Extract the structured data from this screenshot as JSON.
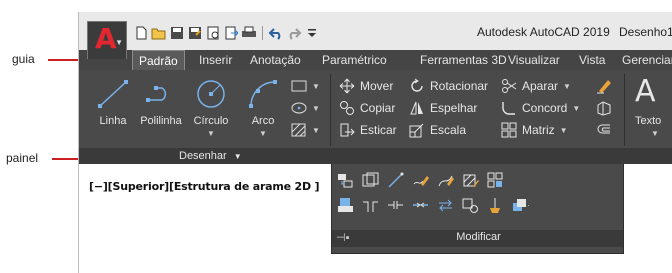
{
  "callouts": {
    "guia": "guia",
    "painel": "painel"
  },
  "titlebar": {
    "app_title": "Autodesk AutoCAD 2019",
    "doc_title": "Desenho1.",
    "logo_letter": "A",
    "quick_access": [
      "new-icon",
      "open-icon",
      "save-icon",
      "save-as-icon",
      "print-preview-icon",
      "export-icon",
      "plot-icon",
      "undo-icon",
      "redo-icon",
      "customize-icon"
    ]
  },
  "tabs": [
    "Padrão",
    "Inserir",
    "Anotação",
    "Paramétrico",
    "Ferramentas 3D",
    "Visualizar",
    "Vista",
    "Gerenciar"
  ],
  "ribbon": {
    "draw_panel": {
      "title": "Desenhar",
      "big_tools": [
        {
          "label": "Linha",
          "icon": "line-icon"
        },
        {
          "label": "Polilinha",
          "icon": "polyline-icon"
        },
        {
          "label": "Círculo",
          "icon": "circle-icon"
        },
        {
          "label": "Arco",
          "icon": "arc-icon"
        }
      ],
      "small_tools": [
        "rectangle-icon",
        "ellipse-icon",
        "hatch-icon"
      ]
    },
    "modify_panel": {
      "title": "Modificar",
      "tools": [
        {
          "label": "Mover",
          "icon": "move-icon"
        },
        {
          "label": "Rotacionar",
          "icon": "rotate-icon"
        },
        {
          "label": "Aparar",
          "icon": "trim-icon"
        },
        {
          "label": "Copiar",
          "icon": "copy-icon"
        },
        {
          "label": "Espelhar",
          "icon": "mirror-icon"
        },
        {
          "label": "Concord",
          "icon": "fillet-icon"
        },
        {
          "label": "Esticar",
          "icon": "stretch-icon"
        },
        {
          "label": "Escala",
          "icon": "scale-icon"
        },
        {
          "label": "Matriz",
          "icon": "array-icon"
        }
      ]
    },
    "annotation_panel": {
      "text_label": "Texto",
      "text_letter": "A"
    }
  },
  "viewport": {
    "label": "[−][Superior][Estrutura de arame 2D ]"
  },
  "colors": {
    "ribbon_bg": "#4a4a4a",
    "tab_bg": "#454545",
    "accent_red": "#cc1f1f",
    "logo_red": "#e3262f"
  }
}
